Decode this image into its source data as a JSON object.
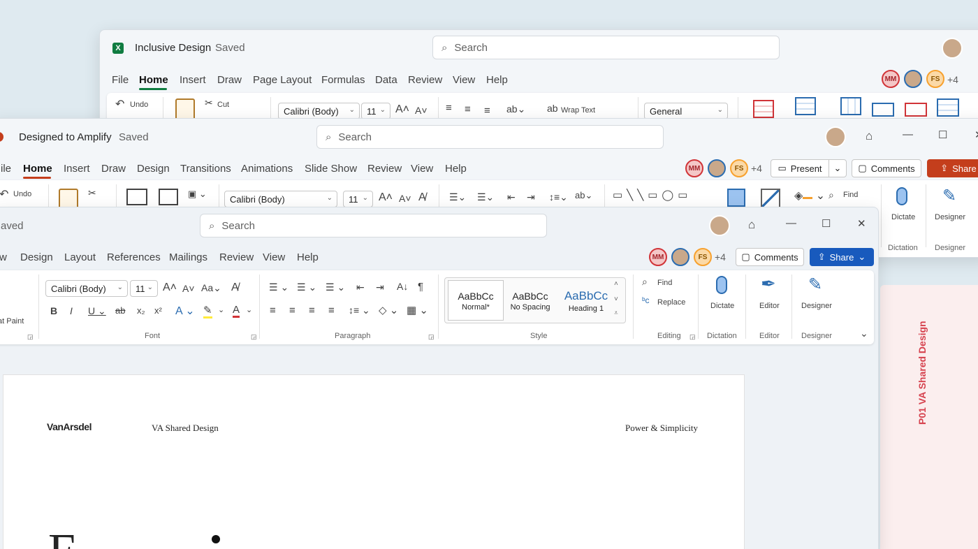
{
  "excel": {
    "title": "Inclusive Design",
    "status": "Saved",
    "search_placeholder": "Search",
    "menu": [
      "File",
      "Home",
      "Insert",
      "Draw",
      "Page Layout",
      "Formulas",
      "Data",
      "Review",
      "View",
      "Help"
    ],
    "undo_label": "Undo",
    "cut_label": "Cut",
    "font": "Calibri (Body)",
    "font_size": "11",
    "wrap_text_label": "Wrap Text",
    "number_format": "General",
    "collab_more": "+4"
  },
  "powerpoint": {
    "title": "Designed to Amplify",
    "status": "Saved",
    "search_placeholder": "Search",
    "menu": [
      "ile",
      "Home",
      "Insert",
      "Draw",
      "Design",
      "Transitions",
      "Animations",
      "Slide Show",
      "Review",
      "View",
      "Help"
    ],
    "undo_label": "Undo",
    "font": "Calibri (Body)",
    "font_size": "11",
    "find_label": "Find",
    "dictate_label": "Dictate",
    "designer_label": "Designer",
    "group_dictation": "Dictation",
    "group_designer": "Designer",
    "present_label": "Present",
    "comments_label": "Comments",
    "share_label": "Share",
    "collab_more": "+4"
  },
  "word": {
    "status": "aved",
    "search_placeholder": "Search",
    "menu": [
      "w",
      "Design",
      "Layout",
      "References",
      "Mailings",
      "Review",
      "View",
      "Help"
    ],
    "comments_label": "Comments",
    "share_label": "Share",
    "collab_more": "+4",
    "format_paint_label": "at Paint",
    "font": "Calibri (Body)",
    "font_size": "11",
    "styles": [
      {
        "preview": "AaBbCc",
        "name": "Normal*"
      },
      {
        "preview": "AaBbCc",
        "name": "No Spacing"
      },
      {
        "preview": "AaBbCc",
        "name": "Heading 1"
      }
    ],
    "find_label": "Find",
    "replace_label": "Replace",
    "dictate_label": "Dictate",
    "editor_label": "Editor",
    "designer_label": "Designer",
    "groups": {
      "font": "Font",
      "paragraph": "Paragraph",
      "style": "Style",
      "editing": "Editing",
      "dictation": "Dictation",
      "editor": "Editor",
      "designer": "Designer"
    }
  },
  "document": {
    "logo": "VanArsdel",
    "header_center": "VA Shared Design",
    "header_right": "Power & Simplicity",
    "big_letter": "F"
  },
  "slide_panel": {
    "vertical_text": "P01   VA Shared Design"
  },
  "avatars": {
    "mm": "MM",
    "fs": "FS"
  },
  "colors": {
    "excel_green": "#107c41",
    "ppt_red": "#c43e1c",
    "word_blue": "#185abd",
    "accent_pink": "#d6424e"
  }
}
